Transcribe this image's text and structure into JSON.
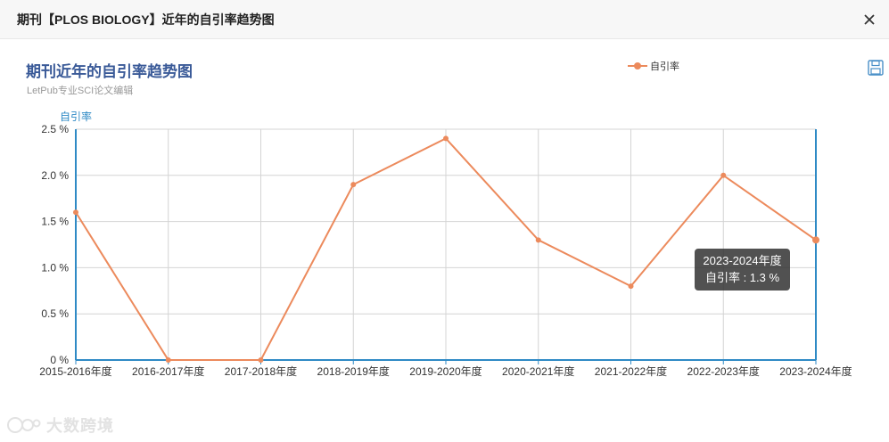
{
  "dialog": {
    "title": "期刊【PLOS BIOLOGY】近年的自引率趋势图"
  },
  "chart_header": {
    "title": "期刊近年的自引率趋势图",
    "subtitle": "LetPub专业SCI论文编辑"
  },
  "watermark": "大数跨境",
  "colors": {
    "series": "#ec8a5c",
    "axis": "#2f8ac5",
    "title": "#3a5a98",
    "grid": "#d4d4d4"
  },
  "icons": {
    "close": "close-icon",
    "save": "save-icon",
    "watermark": "logo-icon"
  },
  "tooltip": {
    "category": "2023-2024年度",
    "text": "自引率 : 1.3 %"
  },
  "chart_data": {
    "type": "line",
    "categories": [
      "2015-2016年度",
      "2016-2017年度",
      "2017-2018年度",
      "2018-2019年度",
      "2019-2020年度",
      "2020-2021年度",
      "2021-2022年度",
      "2022-2023年度",
      "2023-2024年度"
    ],
    "series": [
      {
        "name": "自引率",
        "values": [
          1.6,
          0,
          0,
          1.9,
          2.4,
          1.3,
          0.8,
          2.0,
          1.3
        ]
      }
    ],
    "ylabel": "自引率",
    "ylim": [
      0,
      2.5
    ],
    "yticks": [
      "0 %",
      "0.5 %",
      "1.0 %",
      "1.5 %",
      "2.0 %",
      "2.5 %"
    ],
    "grid": true,
    "legend_position": "top-right"
  }
}
